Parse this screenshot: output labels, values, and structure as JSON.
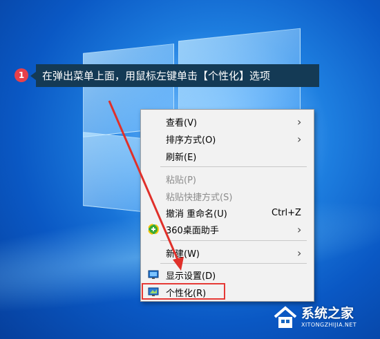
{
  "callout": {
    "step_number": "1",
    "text": "在弹出菜单上面，用鼠标左键单击【个性化】选项"
  },
  "context_menu": {
    "items": [
      {
        "label": "查看(V)",
        "submenu": true,
        "enabled": true
      },
      {
        "label": "排序方式(O)",
        "submenu": true,
        "enabled": true
      },
      {
        "label": "刷新(E)",
        "enabled": true
      },
      {
        "label": "粘贴(P)",
        "enabled": false
      },
      {
        "label": "粘贴快捷方式(S)",
        "enabled": false
      },
      {
        "label": "撤消 重命名(U)",
        "shortcut": "Ctrl+Z",
        "enabled": true
      },
      {
        "label": "360桌面助手",
        "submenu": true,
        "enabled": true,
        "icon": "360-icon"
      },
      {
        "label": "新建(W)",
        "submenu": true,
        "enabled": true
      },
      {
        "label": "显示设置(D)",
        "enabled": true,
        "icon": "display-settings-icon"
      },
      {
        "label": "个性化(R)",
        "enabled": true,
        "icon": "personalize-icon",
        "highlighted": true
      }
    ],
    "submenu_arrow": "›"
  },
  "colors": {
    "highlight": "#e53935",
    "callout_bg": "#143a55",
    "badge": "#e8404a",
    "menu_bg": "#f2f2f2"
  },
  "watermark": {
    "title": "系统之家",
    "subtitle": "XITONGZHIJIA.NET",
    "icon": "house-logo-icon"
  }
}
